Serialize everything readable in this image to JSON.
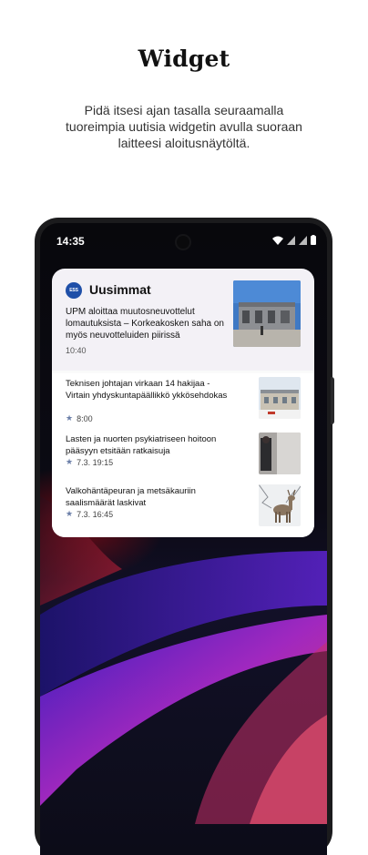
{
  "promo": {
    "title": "Widget",
    "subtitle": "Pidä itsesi ajan tasalla seuraamalla tuoreimpia uutisia widgetin avulla suoraan laitteesi aloitusnäytöltä."
  },
  "status_bar": {
    "time": "14:35",
    "icons": [
      "wifi-icon",
      "signal-icon",
      "signal-icon",
      "battery-icon"
    ]
  },
  "widget": {
    "logo_text": "ESS",
    "brand": "Uusimmat",
    "top_story": {
      "headline": "UPM aloittaa muutosneuvottelut lomautuksista – Korkeakosken saha on myös neuvotteluiden piirissä",
      "time": "10:40",
      "thumb_icon": "factory-photo"
    },
    "items": [
      {
        "title": "Teknisen johtajan virkaan 14 hakijaa - Virtain yhdyskuntapäällikkö ykkösehdokas",
        "time": "8:00",
        "thumb_icon": "building-photo"
      },
      {
        "title": "Lasten ja nuorten psykiatriseen hoitoon pääsyyn etsitään ratkaisuja",
        "time": "7.3. 19:15",
        "thumb_icon": "person-photo"
      },
      {
        "title": "Valkohäntäpeuran ja metsäkauriin saalismäärät laskivat",
        "time": "7.3. 16:45",
        "thumb_icon": "deer-photo"
      }
    ]
  },
  "colors": {
    "logo": "#1f4fa8",
    "widget_bg": "#f3f1f6",
    "phone": "#1b1b1d"
  }
}
